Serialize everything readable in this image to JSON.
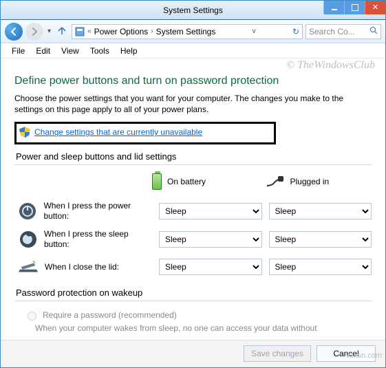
{
  "window": {
    "title": "System Settings",
    "watermark": "© TheWindowsClub",
    "domain_note": "vsxsn.com"
  },
  "nav": {
    "back": "←",
    "fwd": "→",
    "up": "↑",
    "breadcrumb_glyph": "«",
    "crumbs": [
      "Power Options",
      "System Settings"
    ],
    "search_placeholder": "Search Co...",
    "search_icon": "🔍",
    "refresh_glyph": "↻"
  },
  "menubar": [
    "File",
    "Edit",
    "View",
    "Tools",
    "Help"
  ],
  "page": {
    "heading": "Define power buttons and turn on password protection",
    "description": "Choose the power settings that you want for your computer. The changes you make to the settings on this page apply to all of your power plans.",
    "change_link": "Change settings that are currently unavailable"
  },
  "buttons_section": {
    "title": "Power and sleep buttons and lid settings",
    "col_battery": "On battery",
    "col_plugged": "Plugged in",
    "rows": [
      {
        "label": "When I press the power button:",
        "battery": "Sleep",
        "plugged": "Sleep"
      },
      {
        "label": "When I press the sleep button:",
        "battery": "Sleep",
        "plugged": "Sleep"
      },
      {
        "label": "When I close the lid:",
        "battery": "Sleep",
        "plugged": "Sleep"
      }
    ]
  },
  "password_section": {
    "title": "Password protection on wakeup",
    "option_label": "Require a password (recommended)",
    "description": "When your computer wakes from sleep, no one can access your data without"
  },
  "footer": {
    "save": "Save changes",
    "cancel": "Cancel"
  }
}
